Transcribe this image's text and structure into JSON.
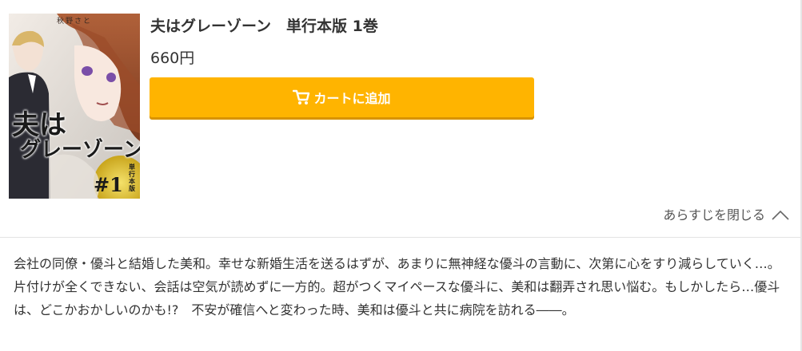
{
  "book": {
    "title": "夫はグレーゾーン　単行本版 1巻",
    "price": "660円"
  },
  "cover": {
    "author": "秋野さと",
    "title_line1": "夫は",
    "title_line2": "グレーゾーン",
    "volume": "#1",
    "edition": "単行本版"
  },
  "actions": {
    "add_to_cart_label": "カートに追加",
    "toggle_synopsis_label": "あらすじを閉じる"
  },
  "synopsis": {
    "text": "会社の同僚・優斗と結婚した美和。幸せな新婚生活を送るはずが、あまりに無神経な優斗の言動に、次第に心をすり減らしていく…。片付けが全くできない、会話は空気が読めずに一方的。超がつくマイペースな優斗に、美和は翻弄され思い悩む。もしかしたら…優斗は、どこかおかしいのかも!?　不安が確信へと変わった時、美和は優斗と共に病院を訪れる――。"
  },
  "colors": {
    "cart_button": "#ffb400",
    "cart_button_shadow": "#d89300",
    "text": "#333333",
    "divider": "#e3e3e3"
  },
  "icons": {
    "cart": "cart-icon",
    "toggle": "chevron-up-icon"
  }
}
